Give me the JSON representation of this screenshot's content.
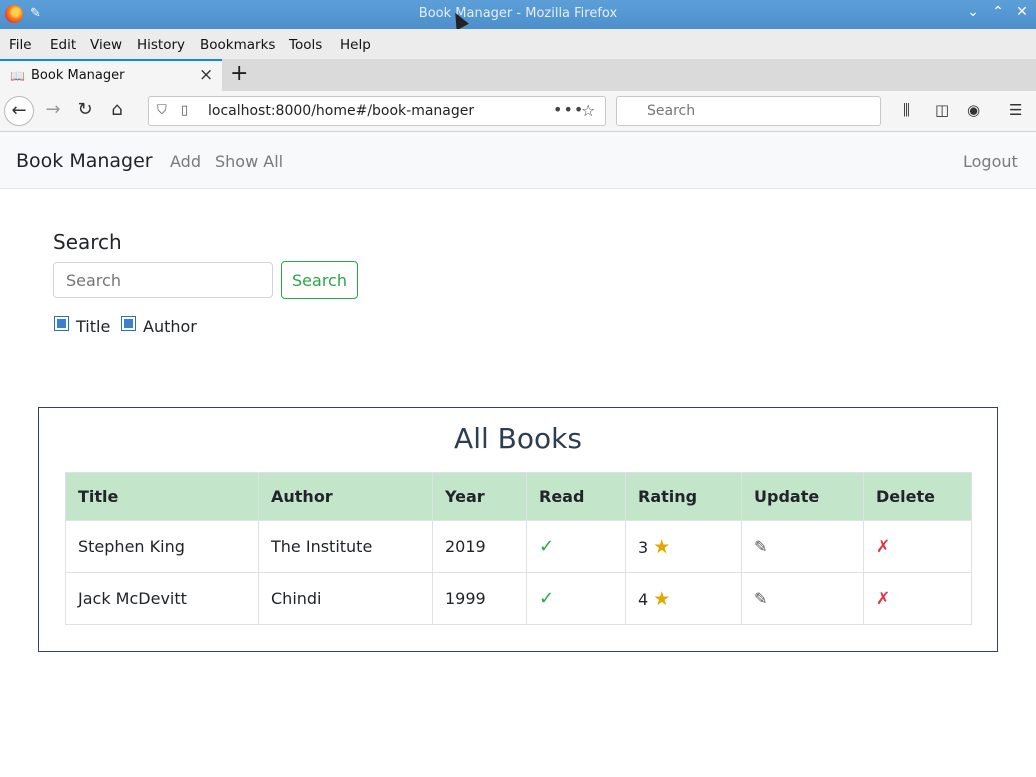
{
  "window": {
    "title": "Book Manager - Mozilla Firefox"
  },
  "menu": [
    "File",
    "Edit",
    "View",
    "History",
    "Bookmarks",
    "Tools",
    "Help"
  ],
  "tab": {
    "label": "Book Manager"
  },
  "nav": {
    "url": "localhost:8000/home#/book-manager",
    "search_placeholder": "Search"
  },
  "app": {
    "brand": "Book Manager",
    "links": [
      "Add",
      "Show All"
    ],
    "logout": "Logout"
  },
  "search": {
    "heading": "Search",
    "placeholder": "Search",
    "button": "Search",
    "filters": [
      {
        "label": "Title",
        "checked": true
      },
      {
        "label": "Author",
        "checked": true
      }
    ]
  },
  "books": {
    "title": "All Books",
    "columns": [
      "Title",
      "Author",
      "Year",
      "Read",
      "Rating",
      "Update",
      "Delete"
    ],
    "rows": [
      {
        "title": "Stephen King",
        "author": "The Institute",
        "year": "2019",
        "read": "✓",
        "rating": "3",
        "update": "✎",
        "delete": "✗"
      },
      {
        "title": "Jack McDevitt",
        "author": "Chindi",
        "year": "1999",
        "read": "✓",
        "rating": "4",
        "update": "✎",
        "delete": "✗"
      }
    ],
    "star": "★"
  },
  "colors": {
    "accent": "#28a745",
    "header_row": "#c3e6cb",
    "danger": "#dc3545",
    "star": "#e0a800"
  }
}
